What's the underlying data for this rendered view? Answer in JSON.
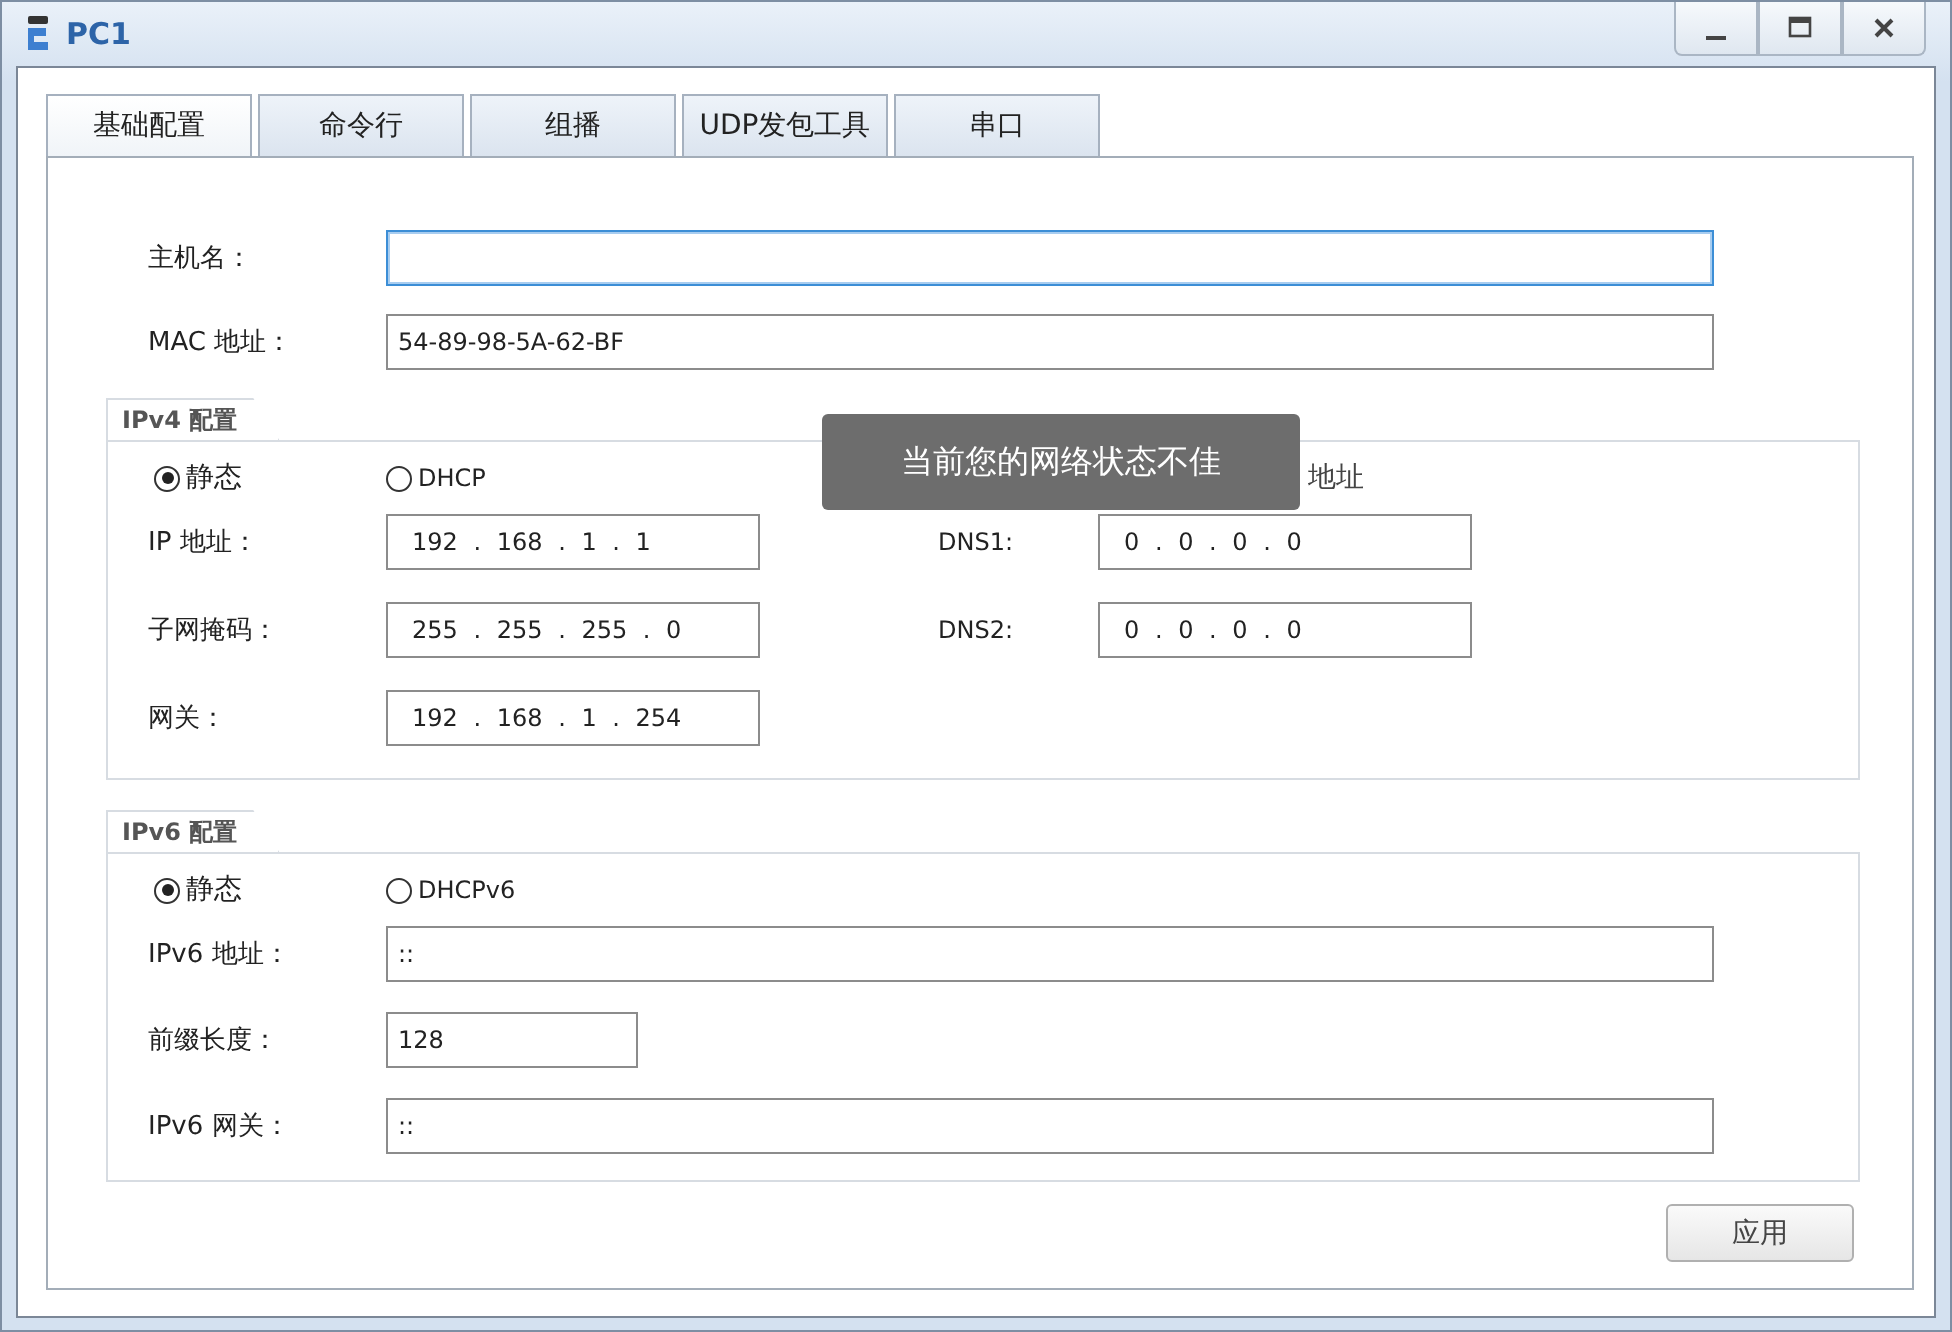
{
  "window": {
    "title": "PC1"
  },
  "tabs": [
    {
      "label": "基础配置",
      "selected": true
    },
    {
      "label": "命令行",
      "selected": false
    },
    {
      "label": "组播",
      "selected": false
    },
    {
      "label": "UDP发包工具",
      "selected": false
    },
    {
      "label": "串口",
      "selected": false
    }
  ],
  "host": {
    "label": "主机名：",
    "focused": true
  },
  "mac": {
    "label": "MAC 地址：",
    "value": "54-89-98-5A-62-BF",
    "focused": false
  },
  "ipv4": {
    "title": "IPv4 配置",
    "modes": [
      {
        "label": "静态",
        "selected": true
      },
      {
        "label": "DHCP",
        "selected": false
      }
    ],
    "dns_auto_label": "地址",
    "rows": [
      {
        "label": "IP 地址：",
        "value": "192 . 168 . 1 . 1",
        "dns_label": "DNS1:",
        "dns_value": "0 . 0 . 0 . 0"
      },
      {
        "label": "子网掩码：",
        "value": "255 . 255 . 255 . 0",
        "dns_label": "DNS2:",
        "dns_value": "0 . 0 . 0 . 0"
      },
      {
        "label": "网关：",
        "value": "192 . 168 . 1 . 254"
      }
    ]
  },
  "ipv6": {
    "title": "IPv6 配置",
    "modes": [
      {
        "label": "静态",
        "selected": true
      },
      {
        "label": "DHCPv6",
        "selected": false
      }
    ],
    "rows": [
      {
        "label": "IPv6 地址：",
        "value": "::",
        "kind": "wide"
      },
      {
        "label": "前缀长度：",
        "value": "128",
        "kind": "short"
      },
      {
        "label": "IPv6 网关：",
        "value": "::",
        "kind": "wide"
      }
    ]
  },
  "apply_button": "应用",
  "toast": "当前您的网络状态不佳"
}
